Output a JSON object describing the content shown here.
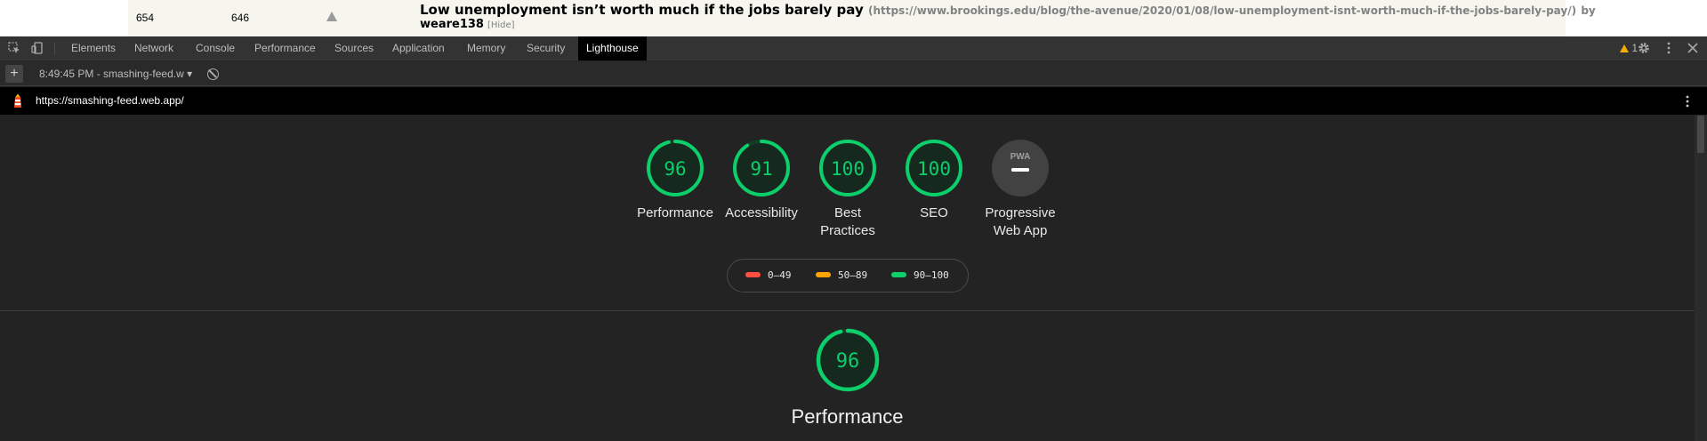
{
  "page": {
    "col1": "654",
    "col2": "646",
    "story_title": "Low unemployment isn’t worth much if the jobs barely pay",
    "story_url": "(https://www.brookings.edu/blog/the-avenue/2020/01/08/low-unemployment-isnt-worth-much-if-the-jobs-barely-pay/)",
    "story_by_prefix": "by",
    "story_author": "weare138",
    "story_hide": "[Hide]"
  },
  "devtools": {
    "tabs": [
      "Elements",
      "Network",
      "Console",
      "Performance",
      "Sources",
      "Application",
      "Memory",
      "Security",
      "Lighthouse"
    ],
    "active_tab": "Lighthouse",
    "warning_count": "1"
  },
  "report_bar": {
    "plus_label": "+",
    "report_selector": "8:49:45 PM - smashing-feed.w",
    "dropdown_arrow": "▾"
  },
  "url_bar": {
    "url": "https://smashing-feed.web.app/"
  },
  "scores": [
    {
      "label_line1": "Performance",
      "label_line2": "",
      "score": "96",
      "fraction": 0.96
    },
    {
      "label_line1": "Accessibility",
      "label_line2": "",
      "score": "91",
      "fraction": 0.91
    },
    {
      "label_line1": "Best",
      "label_line2": "Practices",
      "score": "100",
      "fraction": 1.0
    },
    {
      "label_line1": "SEO",
      "label_line2": "",
      "score": "100",
      "fraction": 1.0
    },
    {
      "label_line1": "Progressive",
      "label_line2": "Web App",
      "badge_text": "PWA"
    }
  ],
  "legend": [
    {
      "range": "0–49",
      "color": "#ff4e42"
    },
    {
      "range": "50–89",
      "color": "#ffa400"
    },
    {
      "range": "90–100",
      "color": "#0cce6b"
    }
  ],
  "section": {
    "title": "Performance",
    "score": "96",
    "fraction": 0.96
  },
  "colors": {
    "pass": "#0cce6b",
    "gauge_track": "#133d26",
    "gauge_fill": "#15291e"
  }
}
